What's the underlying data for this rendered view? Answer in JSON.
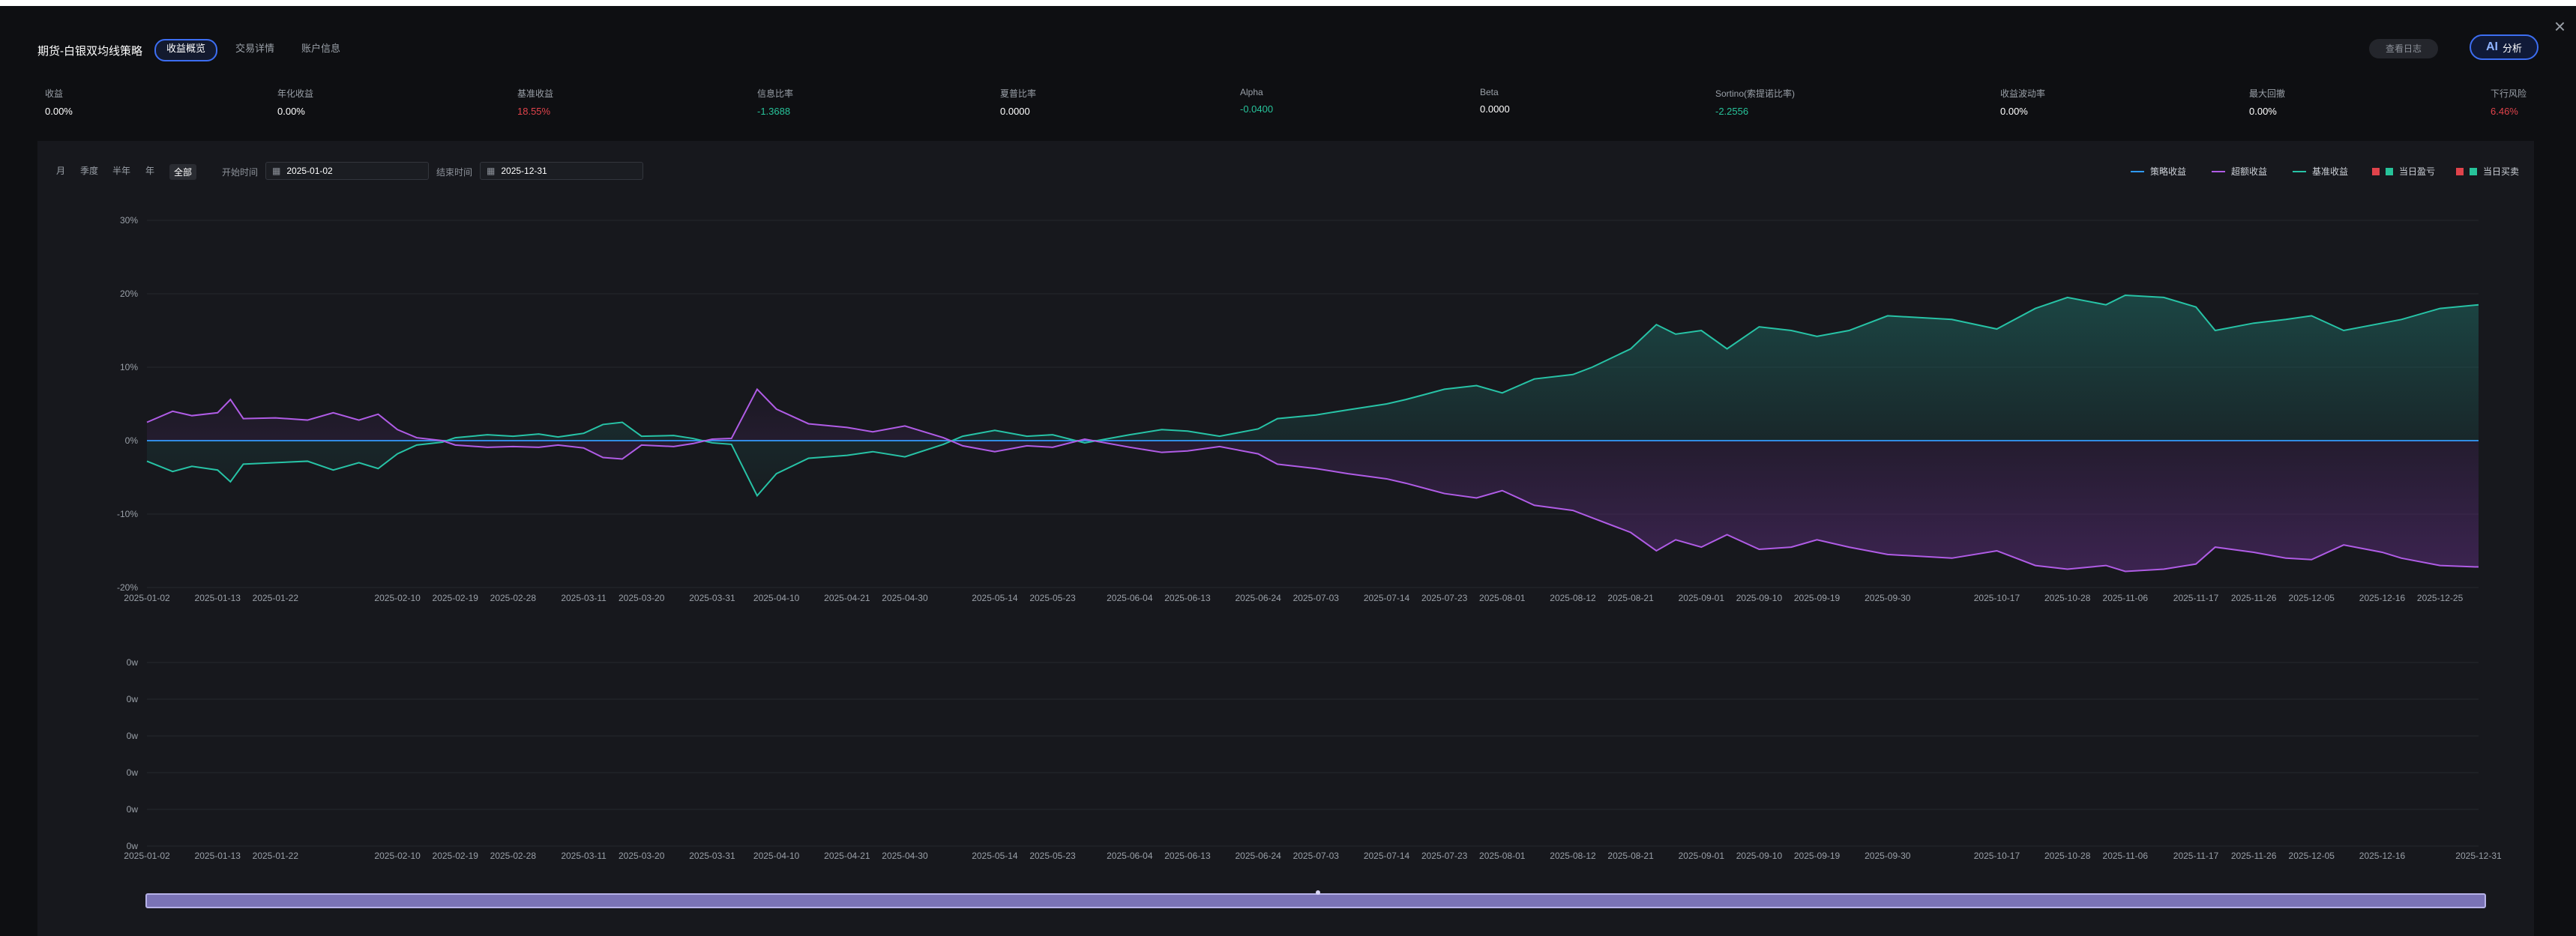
{
  "window": {
    "title": "期货-白银双均线策略",
    "tabs": [
      "收益概览",
      "交易详情",
      "账户信息"
    ],
    "active_tab": 0,
    "log_button": "查看日志",
    "ai_button": {
      "icon_text": "AI",
      "label": "分析"
    },
    "close_icon": "close-icon"
  },
  "metrics": [
    {
      "label": "收益",
      "value": "0.00%",
      "tone": "neutral"
    },
    {
      "label": "年化收益",
      "value": "0.00%",
      "tone": "neutral"
    },
    {
      "label": "基准收益",
      "value": "18.55%",
      "tone": "red"
    },
    {
      "label": "信息比率",
      "value": "-1.3688",
      "tone": "green"
    },
    {
      "label": "夏普比率",
      "value": "0.0000",
      "tone": "neutral"
    },
    {
      "label": "Alpha",
      "value": "-0.0400",
      "tone": "green"
    },
    {
      "label": "Beta",
      "value": "0.0000",
      "tone": "neutral"
    },
    {
      "label": "Sortino(索提诺比率)",
      "value": "-2.2556",
      "tone": "green"
    },
    {
      "label": "收益波动率",
      "value": "0.00%",
      "tone": "neutral"
    },
    {
      "label": "最大回撤",
      "value": "0.00%",
      "tone": "neutral"
    },
    {
      "label": "下行风险",
      "value": "6.46%",
      "tone": "red"
    }
  ],
  "filters": {
    "periods": [
      "月",
      "季度",
      "半年",
      "年",
      "全部"
    ],
    "active_period": 4,
    "start_label": "开始时间",
    "start_value": "2025-01-02",
    "end_label": "结束时间",
    "end_value": "2025-12-31",
    "calendar_icon": "calendar-icon"
  },
  "legend": [
    {
      "name": "策略收益",
      "color": "#2f9bff",
      "kind": "line"
    },
    {
      "name": "超额收益",
      "color": "#b05ce6",
      "kind": "line"
    },
    {
      "name": "基准收益",
      "color": "#27c3a6",
      "kind": "line"
    },
    {
      "name": "当日盈亏",
      "color": "#e0434b",
      "color2": "#27c39a",
      "kind": "squares"
    },
    {
      "name": "当日买卖",
      "color": "#e0434b",
      "color2": "#27c39a",
      "kind": "squares"
    }
  ],
  "chart_data": [
    {
      "type": "line",
      "ylim": [
        -20,
        30
      ],
      "yticks": [
        "30%",
        "20%",
        "10%",
        "0%",
        "-10%",
        "-20%"
      ],
      "xticks": [
        "2025-01-02",
        "2025-01-13",
        "2025-01-22",
        "2025-02-10",
        "2025-02-19",
        "2025-02-28",
        "2025-03-11",
        "2025-03-20",
        "2025-03-31",
        "2025-04-10",
        "2025-04-21",
        "2025-04-30",
        "2025-05-14",
        "2025-05-23",
        "2025-06-04",
        "2025-06-13",
        "2025-06-24",
        "2025-07-03",
        "2025-07-14",
        "2025-07-23",
        "2025-08-01",
        "2025-08-12",
        "2025-08-21",
        "2025-09-01",
        "2025-09-10",
        "2025-09-19",
        "2025-09-30",
        "2025-10-17",
        "2025-10-28",
        "2025-11-06",
        "2025-11-17",
        "2025-11-26",
        "2025-12-05",
        "2025-12-16",
        "2025-12-25"
      ],
      "x_start": "2025-01-02",
      "x_end": "2025-12-31",
      "series": [
        {
          "name": "策略收益",
          "color": "#2f9bff",
          "points": [
            [
              "2025-01-02",
              0
            ],
            [
              "2025-12-31",
              0
            ]
          ]
        },
        {
          "name": "基准收益",
          "color": "#27c3a6",
          "fill": true,
          "points": [
            [
              "2025-01-02",
              -2.8
            ],
            [
              "2025-01-06",
              -4.2
            ],
            [
              "2025-01-09",
              -3.5
            ],
            [
              "2025-01-13",
              -4.0
            ],
            [
              "2025-01-15",
              -5.6
            ],
            [
              "2025-01-17",
              -3.2
            ],
            [
              "2025-01-22",
              -3.0
            ],
            [
              "2025-01-27",
              -2.8
            ],
            [
              "2025-01-31",
              -4.0
            ],
            [
              "2025-02-04",
              -3.0
            ],
            [
              "2025-02-07",
              -3.8
            ],
            [
              "2025-02-10",
              -1.8
            ],
            [
              "2025-02-13",
              -0.6
            ],
            [
              "2025-02-17",
              -0.2
            ],
            [
              "2025-02-19",
              0.4
            ],
            [
              "2025-02-24",
              0.8
            ],
            [
              "2025-02-28",
              0.6
            ],
            [
              "2025-03-04",
              0.9
            ],
            [
              "2025-03-07",
              0.5
            ],
            [
              "2025-03-11",
              1.0
            ],
            [
              "2025-03-14",
              2.2
            ],
            [
              "2025-03-17",
              2.5
            ],
            [
              "2025-03-20",
              0.6
            ],
            [
              "2025-03-25",
              0.7
            ],
            [
              "2025-03-28",
              0.3
            ],
            [
              "2025-03-31",
              -0.3
            ],
            [
              "2025-04-03",
              -0.5
            ],
            [
              "2025-04-07",
              -7.5
            ],
            [
              "2025-04-10",
              -4.5
            ],
            [
              "2025-04-15",
              -2.4
            ],
            [
              "2025-04-21",
              -2.0
            ],
            [
              "2025-04-25",
              -1.5
            ],
            [
              "2025-04-30",
              -2.2
            ],
            [
              "2025-05-06",
              -0.5
            ],
            [
              "2025-05-09",
              0.6
            ],
            [
              "2025-05-14",
              1.4
            ],
            [
              "2025-05-19",
              0.6
            ],
            [
              "2025-05-23",
              0.8
            ],
            [
              "2025-05-28",
              -0.3
            ],
            [
              "2025-06-04",
              0.8
            ],
            [
              "2025-06-09",
              1.5
            ],
            [
              "2025-06-13",
              1.3
            ],
            [
              "2025-06-18",
              0.6
            ],
            [
              "2025-06-24",
              1.6
            ],
            [
              "2025-06-27",
              3.0
            ],
            [
              "2025-07-03",
              3.5
            ],
            [
              "2025-07-08",
              4.2
            ],
            [
              "2025-07-14",
              5.0
            ],
            [
              "2025-07-17",
              5.6
            ],
            [
              "2025-07-23",
              7.0
            ],
            [
              "2025-07-28",
              7.5
            ],
            [
              "2025-08-01",
              6.5
            ],
            [
              "2025-08-06",
              8.4
            ],
            [
              "2025-08-12",
              9.0
            ],
            [
              "2025-08-15",
              10.0
            ],
            [
              "2025-08-21",
              12.5
            ],
            [
              "2025-08-25",
              15.8
            ],
            [
              "2025-08-28",
              14.5
            ],
            [
              "2025-09-01",
              15.0
            ],
            [
              "2025-09-05",
              12.5
            ],
            [
              "2025-09-10",
              15.5
            ],
            [
              "2025-09-15",
              15.0
            ],
            [
              "2025-09-19",
              14.2
            ],
            [
              "2025-09-24",
              15.0
            ],
            [
              "2025-09-30",
              17.0
            ],
            [
              "2025-10-10",
              16.5
            ],
            [
              "2025-10-17",
              15.2
            ],
            [
              "2025-10-23",
              18.0
            ],
            [
              "2025-10-28",
              19.5
            ],
            [
              "2025-11-03",
              18.5
            ],
            [
              "2025-11-06",
              19.8
            ],
            [
              "2025-11-12",
              19.5
            ],
            [
              "2025-11-17",
              18.2
            ],
            [
              "2025-11-20",
              15.0
            ],
            [
              "2025-11-26",
              16.0
            ],
            [
              "2025-12-01",
              16.5
            ],
            [
              "2025-12-05",
              17.0
            ],
            [
              "2025-12-10",
              15.0
            ],
            [
              "2025-12-16",
              16.0
            ],
            [
              "2025-12-19",
              16.5
            ],
            [
              "2025-12-25",
              18.0
            ],
            [
              "2025-12-31",
              18.5
            ]
          ]
        },
        {
          "name": "超额收益",
          "color": "#b05ce6",
          "fill": true,
          "points": [
            [
              "2025-01-02",
              2.5
            ],
            [
              "2025-01-06",
              4.0
            ],
            [
              "2025-01-09",
              3.4
            ],
            [
              "2025-01-13",
              3.8
            ],
            [
              "2025-01-15",
              5.6
            ],
            [
              "2025-01-17",
              3.0
            ],
            [
              "2025-01-22",
              3.1
            ],
            [
              "2025-01-27",
              2.8
            ],
            [
              "2025-01-31",
              3.8
            ],
            [
              "2025-02-04",
              2.8
            ],
            [
              "2025-02-07",
              3.6
            ],
            [
              "2025-02-10",
              1.5
            ],
            [
              "2025-02-13",
              0.4
            ],
            [
              "2025-02-17",
              0.0
            ],
            [
              "2025-02-19",
              -0.6
            ],
            [
              "2025-02-24",
              -0.9
            ],
            [
              "2025-02-28",
              -0.8
            ],
            [
              "2025-03-04",
              -0.9
            ],
            [
              "2025-03-07",
              -0.6
            ],
            [
              "2025-03-11",
              -1.0
            ],
            [
              "2025-03-14",
              -2.3
            ],
            [
              "2025-03-17",
              -2.5
            ],
            [
              "2025-03-20",
              -0.6
            ],
            [
              "2025-03-25",
              -0.8
            ],
            [
              "2025-03-28",
              -0.4
            ],
            [
              "2025-03-31",
              0.2
            ],
            [
              "2025-04-03",
              0.3
            ],
            [
              "2025-04-07",
              7.0
            ],
            [
              "2025-04-10",
              4.3
            ],
            [
              "2025-04-15",
              2.3
            ],
            [
              "2025-04-21",
              1.8
            ],
            [
              "2025-04-25",
              1.2
            ],
            [
              "2025-04-30",
              2.0
            ],
            [
              "2025-05-06",
              0.4
            ],
            [
              "2025-05-09",
              -0.7
            ],
            [
              "2025-05-14",
              -1.5
            ],
            [
              "2025-05-19",
              -0.7
            ],
            [
              "2025-05-23",
              -0.9
            ],
            [
              "2025-05-28",
              0.2
            ],
            [
              "2025-06-04",
              -0.9
            ],
            [
              "2025-06-09",
              -1.6
            ],
            [
              "2025-06-13",
              -1.4
            ],
            [
              "2025-06-18",
              -0.8
            ],
            [
              "2025-06-24",
              -1.8
            ],
            [
              "2025-06-27",
              -3.2
            ],
            [
              "2025-07-03",
              -3.8
            ],
            [
              "2025-07-08",
              -4.5
            ],
            [
              "2025-07-14",
              -5.2
            ],
            [
              "2025-07-17",
              -5.8
            ],
            [
              "2025-07-23",
              -7.2
            ],
            [
              "2025-07-28",
              -7.8
            ],
            [
              "2025-08-01",
              -6.8
            ],
            [
              "2025-08-06",
              -8.8
            ],
            [
              "2025-08-12",
              -9.5
            ],
            [
              "2025-08-15",
              -10.5
            ],
            [
              "2025-08-21",
              -12.5
            ],
            [
              "2025-08-25",
              -15.0
            ],
            [
              "2025-08-28",
              -13.5
            ],
            [
              "2025-09-01",
              -14.5
            ],
            [
              "2025-09-05",
              -12.8
            ],
            [
              "2025-09-10",
              -14.8
            ],
            [
              "2025-09-15",
              -14.5
            ],
            [
              "2025-09-19",
              -13.5
            ],
            [
              "2025-09-24",
              -14.5
            ],
            [
              "2025-09-30",
              -15.5
            ],
            [
              "2025-10-10",
              -16.0
            ],
            [
              "2025-10-17",
              -15.0
            ],
            [
              "2025-10-23",
              -17.0
            ],
            [
              "2025-10-28",
              -17.5
            ],
            [
              "2025-11-03",
              -17.0
            ],
            [
              "2025-11-06",
              -17.8
            ],
            [
              "2025-11-12",
              -17.5
            ],
            [
              "2025-11-17",
              -16.8
            ],
            [
              "2025-11-20",
              -14.5
            ],
            [
              "2025-11-26",
              -15.2
            ],
            [
              "2025-12-01",
              -16.0
            ],
            [
              "2025-12-05",
              -16.2
            ],
            [
              "2025-12-10",
              -14.2
            ],
            [
              "2025-12-16",
              -15.2
            ],
            [
              "2025-12-19",
              -16.0
            ],
            [
              "2025-12-25",
              -17.0
            ],
            [
              "2025-12-31",
              -17.2
            ]
          ]
        }
      ]
    },
    {
      "type": "bar",
      "yticks": [
        "0w",
        "0w",
        "0w",
        "0w",
        "0w",
        "0w"
      ],
      "xticks": [
        "2025-01-02",
        "2025-01-13",
        "2025-01-22",
        "2025-02-10",
        "2025-02-19",
        "2025-02-28",
        "2025-03-11",
        "2025-03-20",
        "2025-03-31",
        "2025-04-10",
        "2025-04-21",
        "2025-04-30",
        "2025-05-14",
        "2025-05-23",
        "2025-06-04",
        "2025-06-13",
        "2025-06-24",
        "2025-07-03",
        "2025-07-14",
        "2025-07-23",
        "2025-08-01",
        "2025-08-12",
        "2025-08-21",
        "2025-09-01",
        "2025-09-10",
        "2025-09-19",
        "2025-09-30",
        "2025-10-17",
        "2025-10-28",
        "2025-11-06",
        "2025-11-17",
        "2025-11-26",
        "2025-12-05",
        "2025-12-16",
        "2025-12-31"
      ],
      "series": []
    }
  ],
  "zoom": {
    "start": 0,
    "end": 100
  }
}
